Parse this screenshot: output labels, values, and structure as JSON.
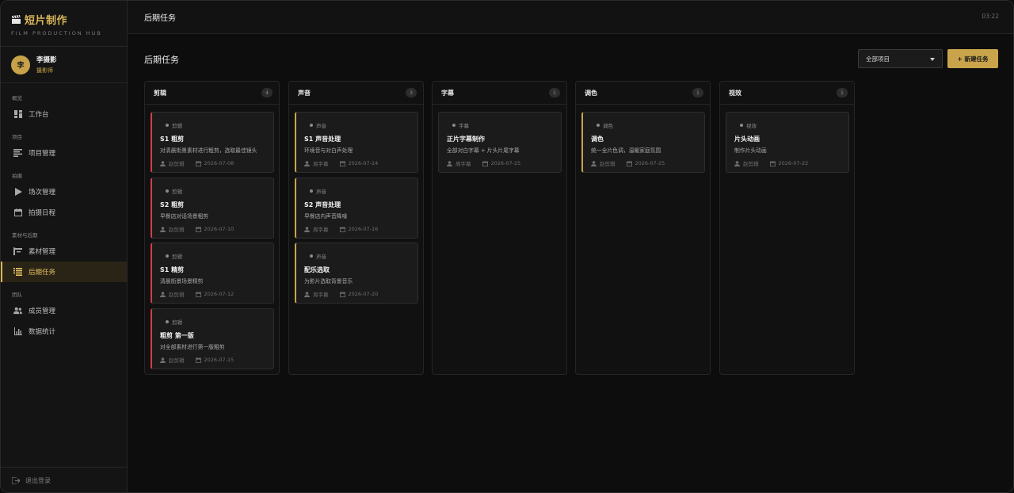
{
  "brand": {
    "title": "短片制作",
    "subtitle": "FILM PRODUCTION HUB"
  },
  "user": {
    "avatar": "李",
    "name": "李摄影",
    "role": "摄影师"
  },
  "nav": {
    "groups": [
      "概览",
      "项目",
      "拍摄",
      "素材与后期",
      "团队"
    ],
    "items": [
      {
        "label": "工作台",
        "icon": "dashboard-icon"
      },
      {
        "label": "项目管理",
        "icon": "list-icon"
      },
      {
        "label": "场次管理",
        "icon": "play-icon"
      },
      {
        "label": "拍摄日程",
        "icon": "calendar-icon"
      },
      {
        "label": "素材管理",
        "icon": "folder-icon"
      },
      {
        "label": "后期任务",
        "icon": "tasks-icon",
        "active": true
      },
      {
        "label": "成员管理",
        "icon": "users-icon"
      },
      {
        "label": "数据统计",
        "icon": "chart-icon"
      }
    ],
    "logout": "退出登录"
  },
  "topbar": {
    "title": "后期任务",
    "clock": "03:22"
  },
  "page": {
    "title": "后期任务",
    "filter": "全部项目",
    "new_button": "+ 新建任务"
  },
  "accent": "#c9a44b",
  "columns": [
    {
      "title": "剪辑",
      "count": "4",
      "cards": [
        {
          "tag": "剪辑",
          "title": "S1 粗剪",
          "desc": "对清晨街景素材进行粗剪，选取最佳镜头",
          "owner": "赵剪辑",
          "date": "2026-07-08",
          "accent": "red"
        },
        {
          "tag": "剪辑",
          "title": "S2 粗剪",
          "desc": "早餐店对话场景粗剪",
          "owner": "赵剪辑",
          "date": "2026-07-10",
          "accent": "red"
        },
        {
          "tag": "剪辑",
          "title": "S1 精剪",
          "desc": "清晨街景场景精剪",
          "owner": "赵剪辑",
          "date": "2026-07-12",
          "accent": "red"
        },
        {
          "tag": "剪辑",
          "title": "粗剪 第一版",
          "desc": "对全部素材进行第一版粗剪",
          "owner": "赵剪辑",
          "date": "2026-07-15",
          "accent": "red"
        }
      ]
    },
    {
      "title": "声音",
      "count": "3",
      "cards": [
        {
          "tag": "声音",
          "title": "S1 声音处理",
          "desc": "环境音与对白声处理",
          "owner": "周字幕",
          "date": "2026-07-14",
          "accent": "yellow"
        },
        {
          "tag": "声音",
          "title": "S2 声音处理",
          "desc": "早餐店内声音降噪",
          "owner": "周字幕",
          "date": "2026-07-16",
          "accent": "yellow"
        },
        {
          "tag": "声音",
          "title": "配乐选取",
          "desc": "为影片选取背景音乐",
          "owner": "周字幕",
          "date": "2026-07-20",
          "accent": "yellow"
        }
      ]
    },
    {
      "title": "字幕",
      "count": "1",
      "cards": [
        {
          "tag": "字幕",
          "title": "正片字幕制作",
          "desc": "全部对白字幕 + 片头片尾字幕",
          "owner": "周字幕",
          "date": "2026-07-25",
          "accent": "none"
        }
      ]
    },
    {
      "title": "调色",
      "count": "1",
      "cards": [
        {
          "tag": "调色",
          "title": "调色",
          "desc": "统一全片色调，温暖家庭氛围",
          "owner": "赵剪辑",
          "date": "2026-07-25",
          "accent": "yellow"
        }
      ]
    },
    {
      "title": "视效",
      "count": "1",
      "cards": [
        {
          "tag": "视效",
          "title": "片头动画",
          "desc": "制作片头动画",
          "owner": "赵剪辑",
          "date": "2026-07-22",
          "accent": "none"
        }
      ]
    }
  ]
}
